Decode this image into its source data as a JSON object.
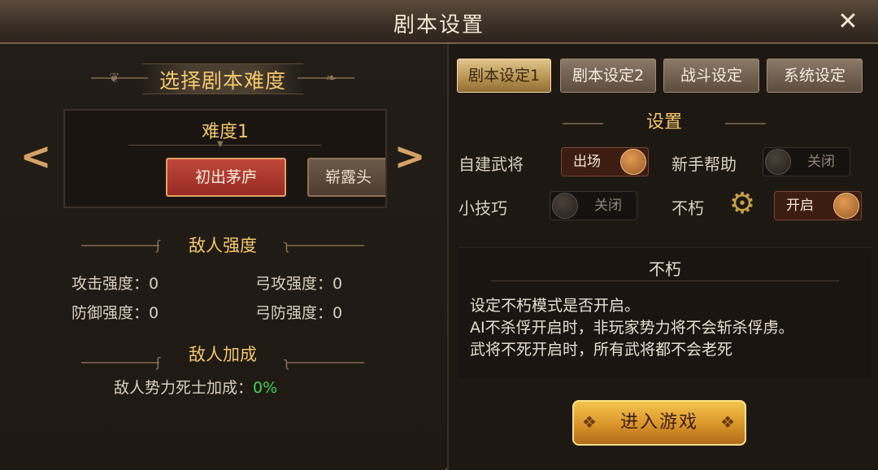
{
  "window": {
    "title": "剧本设置",
    "close_icon": "close-icon"
  },
  "left": {
    "title": "选择剧本难度",
    "difficulty_name": "难度1",
    "mode_active": "初出茅庐",
    "mode_next": "崭露头",
    "enemy_strength": {
      "title": "敌人强度",
      "attack": "攻击强度：0",
      "bow_attack": "弓攻强度：0",
      "defense": "防御强度：0",
      "bow_defense": "弓防强度：0"
    },
    "enemy_bonus": {
      "title": "敌人加成",
      "label": "敌人势力死士加成：",
      "value": "0%"
    }
  },
  "right": {
    "tabs": [
      {
        "label": "剧本设定1",
        "active": true
      },
      {
        "label": "剧本设定2",
        "active": false
      },
      {
        "label": "战斗设定",
        "active": false
      },
      {
        "label": "系统设定",
        "active": false
      }
    ],
    "settings_title": "设置",
    "options": {
      "custom_generals": {
        "label": "自建武将",
        "state": "出场"
      },
      "newbie_help": {
        "label": "新手帮助",
        "state": "关闭"
      },
      "tips": {
        "label": "小技巧",
        "state": "关闭"
      },
      "immortal": {
        "label": "不朽",
        "state": "开启"
      }
    },
    "desc": {
      "title": "不朽",
      "text": "设定不朽模式是否开启。\nAI不杀俘开启时，非玩家势力将不会斩杀俘虏。\n武将不死开启时，所有武将都不会老死"
    },
    "enter_button": "进入游戏"
  },
  "colors": {
    "accent": "#f3c86a",
    "active_red": "#c2483b",
    "green": "#3fd156",
    "gold_button": "#f3c54f"
  }
}
